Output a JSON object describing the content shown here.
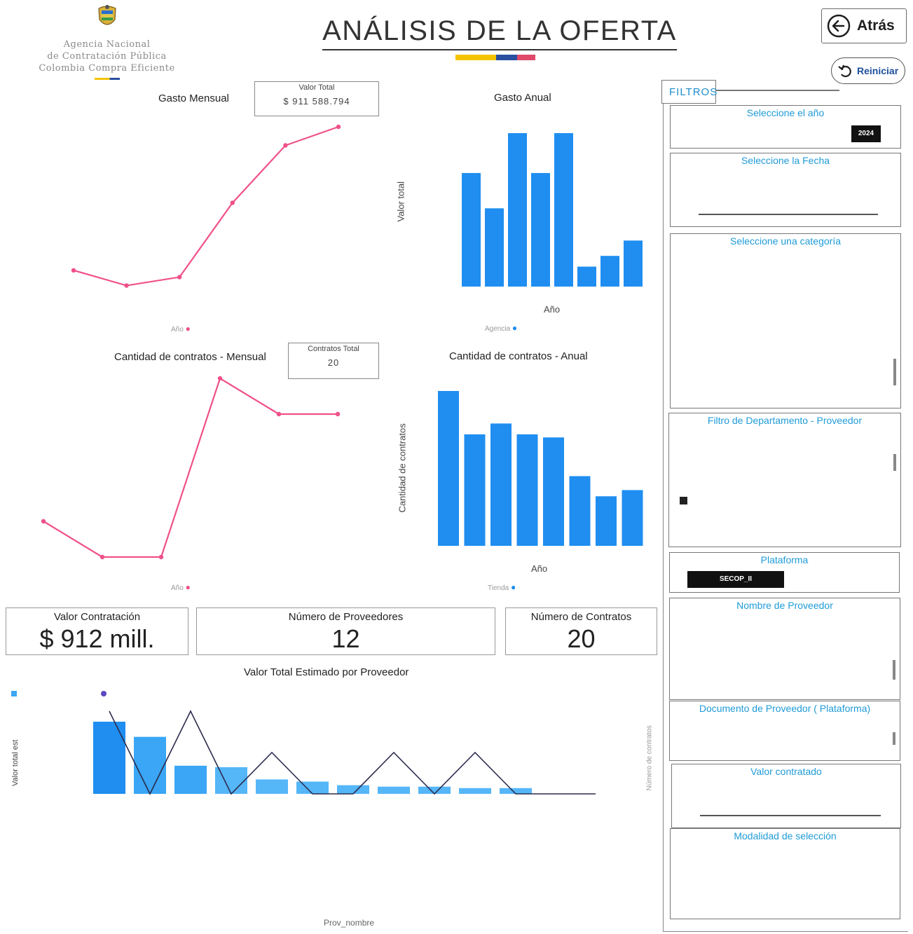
{
  "header": {
    "org_line1": "Agencia Nacional",
    "org_line2": "de Contratación Pública",
    "org_line3": "Colombia Compra Eficiente",
    "title": "ANÁLISIS DE LA OFERTA",
    "back_label": "Atrás",
    "reset_label": "Reiniciar",
    "flag_colors": [
      "#f4c400",
      "#2a4fa0",
      "#e04a6a"
    ]
  },
  "colors": {
    "line": "#f0508a",
    "bar": "#1f8ef0",
    "bar_light": "#3aa6f5",
    "filter_title": "#1f9bd7"
  },
  "gasto_mensual": {
    "title": "Gasto Mensual",
    "kpi_label": "Valor Total",
    "kpi_value": "$ 911 588.794",
    "legend": "Año"
  },
  "gasto_anual": {
    "title": "Gasto Anual",
    "xlabel": "Año",
    "ylabel": "Valor total",
    "legend": "Agencia"
  },
  "contratos_mensual": {
    "title": "Cantidad de contratos - Mensual",
    "kpi_label": "Contratos Total",
    "kpi_value": "20",
    "legend": "Año"
  },
  "contratos_anual": {
    "title": "Cantidad de contratos - Anual",
    "xlabel": "Año",
    "ylabel": "Cantidad de contratos",
    "legend": "Tienda"
  },
  "kpis": {
    "valor_label": "Valor Contratación",
    "valor_value": "$ 912 mill.",
    "proveedores_label": "Número de Proveedores",
    "proveedores_value": "12",
    "contratos_label": "Número de Contratos",
    "contratos_value": "20"
  },
  "proveedor_chart": {
    "title": "Valor Total Estimado por Proveedor",
    "xlabel": "Prov_nombre",
    "ylabel_left": "Valor total est",
    "ylabel_right": "Número de contratos"
  },
  "chart_data": [
    {
      "type": "line",
      "title": "Gasto Mensual",
      "values": [
        0.15,
        0.06,
        0.11,
        0.55,
        0.89,
        1.0
      ]
    },
    {
      "type": "bar",
      "title": "Gasto Anual",
      "xlabel": "Año",
      "ylabel": "Valor total",
      "values": [
        0.74,
        0.51,
        1.0,
        0.74,
        1.0,
        0.13,
        0.2,
        0.3
      ]
    },
    {
      "type": "line",
      "title": "Cantidad de contratos - Mensual",
      "values": [
        0.2,
        0.0,
        0.0,
        1.0,
        0.8,
        0.8
      ]
    },
    {
      "type": "bar",
      "title": "Cantidad de contratos - Anual",
      "xlabel": "Año",
      "ylabel": "Cantidad de contratos",
      "values": [
        1.0,
        0.72,
        0.79,
        0.72,
        0.7,
        0.45,
        0.32,
        0.36
      ]
    },
    {
      "type": "bar",
      "title": "Valor Total Estimado por Proveedor",
      "xlabel": "Prov_nombre",
      "series": [
        {
          "values": [
            1.0,
            0.79,
            0.39,
            0.37,
            0.2,
            0.17,
            0.12,
            0.1,
            0.1,
            0.08,
            0.08,
            0.0
          ]
        },
        {
          "values": [
            1.0,
            0.0,
            1.0,
            0.0,
            0.5,
            0.0,
            0.0,
            0.5,
            0.0,
            0.5,
            0.0,
            0.0
          ]
        }
      ]
    }
  ],
  "filters": {
    "header": "FILTROS",
    "year_title": "Seleccione el año",
    "year_chip": "2024",
    "date_title": "Seleccione la Fecha",
    "category_title": "Seleccione una categoría",
    "department_title": "Filtro de Departamento - Proveedor",
    "platform_title": "Plataforma",
    "platform_chip": "SECOP_II",
    "provider_name_title": "Nombre de Proveedor",
    "provider_doc_title": "Documento de Proveedor ( Plataforma)",
    "value_title": "Valor contratado",
    "modality_title": "Modalidad de selección"
  }
}
